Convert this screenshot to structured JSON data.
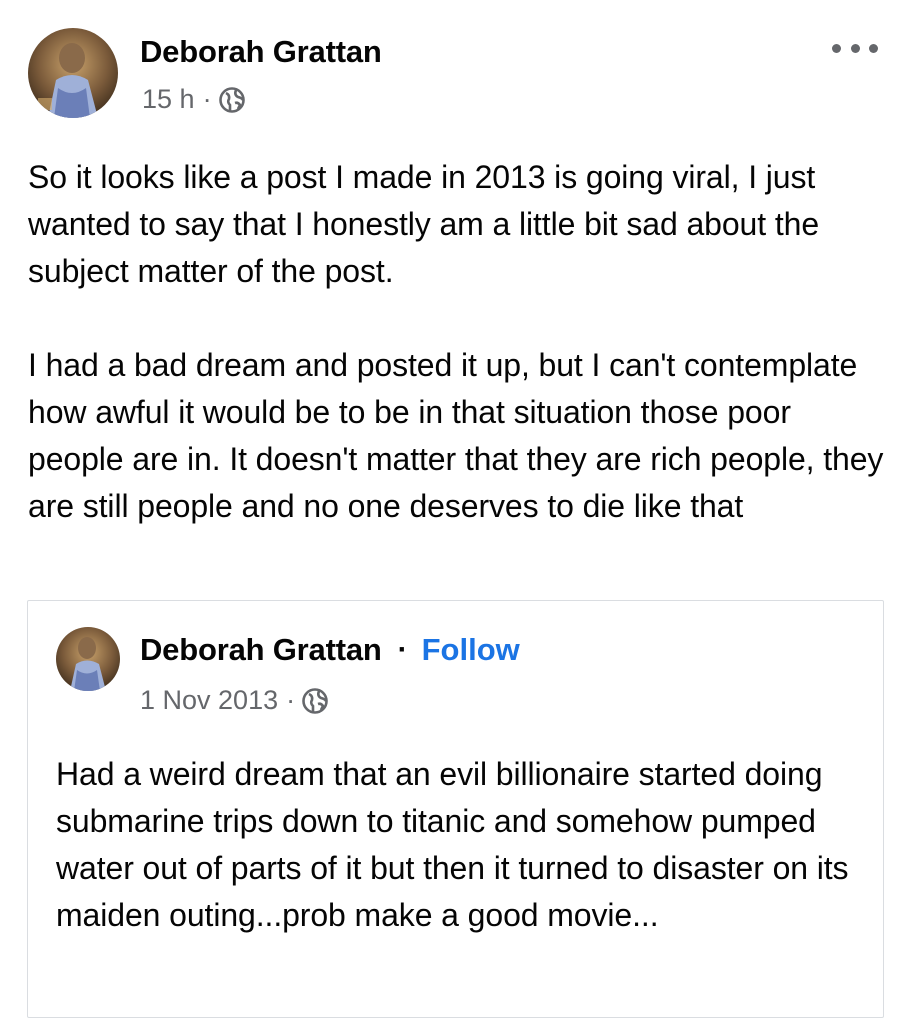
{
  "post": {
    "author": "Deborah Grattan",
    "time": "15 h",
    "dot": "·",
    "visibility_icon": "globe-icon",
    "more_icon": "more-options-icon",
    "paragraphs": [
      "So it looks like a post I made in 2013 is going viral, I just wanted to say that I honestly am a little bit sad about the subject matter of the post.",
      "I had a bad dream and posted it up, but I can't contemplate how awful it would be to be in that situation those poor people are in. It doesn't matter that they are rich people, they are still people and no one deserves to die like that"
    ]
  },
  "shared_post": {
    "author": "Deborah Grattan",
    "separator": "·",
    "follow_label": "Follow",
    "date": "1 Nov 2013",
    "dot": "·",
    "visibility_icon": "globe-icon",
    "text": "Had a weird dream that an evil billionaire started doing submarine trips down to titanic and somehow pumped water out of parts of it but then it turned to disaster on its maiden outing...prob make a good movie..."
  },
  "colors": {
    "text": "#050505",
    "secondary": "#65676b",
    "link": "#1b74e4",
    "border": "#dadde1"
  }
}
